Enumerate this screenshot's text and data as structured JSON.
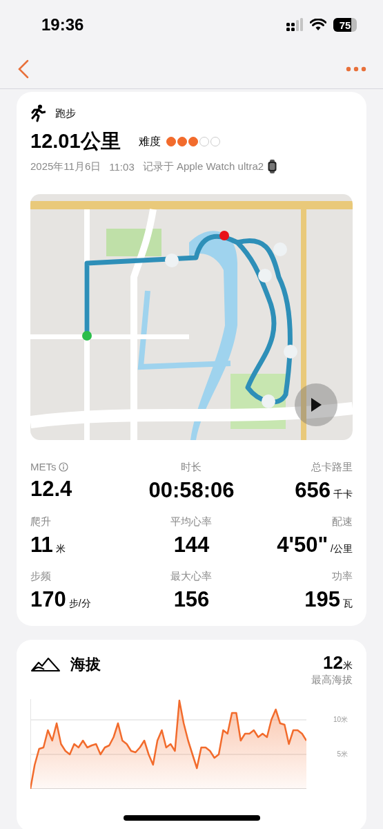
{
  "status_bar": {
    "time": "19:36",
    "battery": "75"
  },
  "workout": {
    "type": "跑步",
    "distance": "12.01",
    "distance_unit": "公里",
    "difficulty_label": "难度",
    "stars": 3,
    "date": "2025年11月6日",
    "time": "11:03",
    "source": "记录于 Apple Watch ultra2"
  },
  "stats": [
    {
      "label": "METs",
      "kind": "info",
      "value": "12.4"
    },
    {
      "label": "时长",
      "kind": "plain",
      "value": "00:58:06"
    },
    {
      "label": "总卡路里",
      "kind": "plain",
      "value": "656",
      "unit": "千卡"
    },
    {
      "label": "爬升",
      "kind": "plain",
      "value": "11",
      "unit": "米"
    },
    {
      "label": "平均心率",
      "kind": "plain",
      "value": "144"
    },
    {
      "label": "配速",
      "kind": "plain",
      "value": "4'50\"",
      "unit": "/公里"
    },
    {
      "label": "步频",
      "kind": "plain",
      "value": "170",
      "unit": "步/分"
    },
    {
      "label": "最大心率",
      "kind": "plain",
      "value": "156"
    },
    {
      "label": "功率",
      "kind": "plain",
      "value": "195",
      "unit": "瓦"
    }
  ],
  "elevation": {
    "max_value": "12",
    "max_unit": "米",
    "max_label": "最高海拔",
    "chart_data": {
      "type": "area",
      "ylim": [
        0,
        13
      ],
      "yticks": [
        {
          "value": 5,
          "label": "5米"
        },
        {
          "value": 10,
          "label": "10米"
        }
      ],
      "series": [
        {
          "name": "海拔",
          "color": "#f26b2c",
          "values": [
            0,
            3.5,
            5.8,
            6,
            8.5,
            7,
            9.5,
            6.5,
            5.5,
            5,
            6.5,
            6,
            7,
            6,
            6.3,
            6.5,
            5,
            6,
            6.3,
            7.5,
            9.5,
            7,
            6.5,
            5.5,
            5.3,
            6,
            7,
            5,
            3.5,
            7,
            8.5,
            6,
            6.5,
            5.5,
            12.8,
            9.5,
            7,
            5,
            3,
            6,
            6,
            5.5,
            4.5,
            5,
            8.5,
            8,
            11,
            11,
            7,
            8,
            8,
            8.5,
            7.5,
            8,
            7.5,
            10,
            11.5,
            9.5,
            9.3,
            6.5,
            8.5,
            8.5,
            8,
            7
          ]
        }
      ]
    }
  }
}
